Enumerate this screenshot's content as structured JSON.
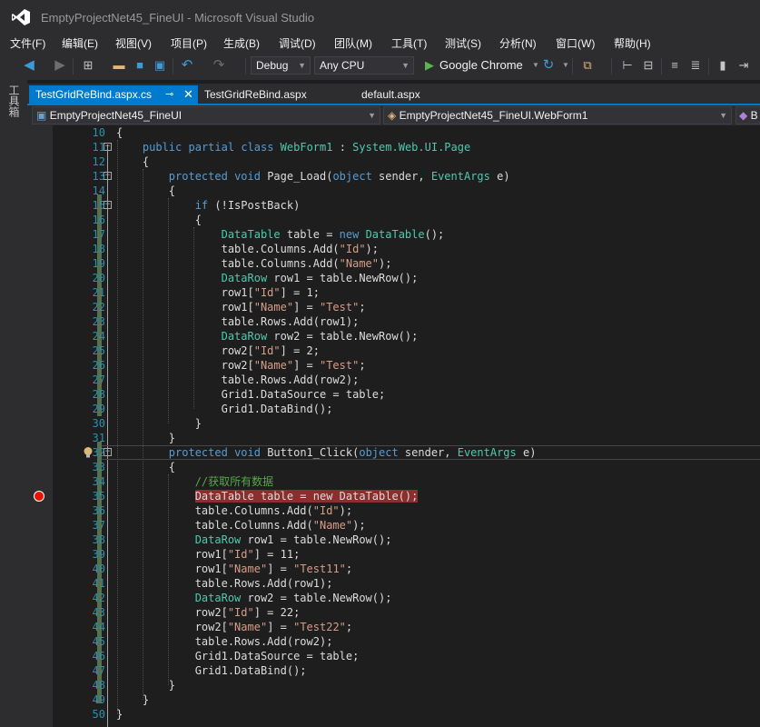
{
  "window": {
    "title": "EmptyProjectNet45_FineUI - Microsoft Visual Studio",
    "logo_icon": "visual-studio-logo-icon"
  },
  "menu": {
    "items": [
      "文件(F)",
      "编辑(E)",
      "视图(V)",
      "项目(P)",
      "生成(B)",
      "调试(D)",
      "团队(M)",
      "工具(T)",
      "测试(S)",
      "分析(N)",
      "窗口(W)",
      "帮助(H)"
    ]
  },
  "toolbar": {
    "configuration": "Debug",
    "platform": "Any CPU",
    "run_target": "Google Chrome",
    "icons": [
      "back-icon",
      "forward-icon",
      "new-project-icon",
      "open-icon",
      "save-icon",
      "save-all-icon",
      "undo-icon",
      "redo-icon",
      "start-icon",
      "refresh-icon",
      "browser-link-icon",
      "format-icon",
      "comment-icon",
      "uncomment-icon",
      "bookmark-icon",
      "next-bookmark-icon"
    ]
  },
  "toolbox": {
    "label": "工具箱"
  },
  "tabs": [
    {
      "label": "TestGridReBind.aspx.cs",
      "active": true,
      "pin": "⊸",
      "close": "✕"
    },
    {
      "label": "TestGridReBind.aspx",
      "active": false
    },
    {
      "label": "default.aspx",
      "active": false
    }
  ],
  "navigation": {
    "project": "EmptyProjectNet45_FineUI",
    "type": "EmptyProjectNet45_FineUI.WebForm1",
    "member": "B"
  },
  "editor": {
    "current_line": 32,
    "breakpoint_line": 35,
    "lightbulb_line": 32,
    "lines": [
      {
        "n": "10",
        "text": "{"
      },
      {
        "n": "11",
        "text": "    public partial class WebForm1 : System.Web.UI.Page"
      },
      {
        "n": "12",
        "text": "    {"
      },
      {
        "n": "13",
        "text": "        protected void Page_Load(object sender, EventArgs e)"
      },
      {
        "n": "14",
        "text": "        {"
      },
      {
        "n": "15",
        "text": "            if (!IsPostBack)"
      },
      {
        "n": "16",
        "text": "            {"
      },
      {
        "n": "17",
        "text": "                DataTable table = new DataTable();"
      },
      {
        "n": "18",
        "text": "                table.Columns.Add(\"Id\");"
      },
      {
        "n": "19",
        "text": "                table.Columns.Add(\"Name\");"
      },
      {
        "n": "20",
        "text": "                DataRow row1 = table.NewRow();"
      },
      {
        "n": "21",
        "text": "                row1[\"Id\"] = 1;"
      },
      {
        "n": "22",
        "text": "                row1[\"Name\"] = \"Test\";"
      },
      {
        "n": "23",
        "text": "                table.Rows.Add(row1);"
      },
      {
        "n": "24",
        "text": "                DataRow row2 = table.NewRow();"
      },
      {
        "n": "25",
        "text": "                row2[\"Id\"] = 2;"
      },
      {
        "n": "26",
        "text": "                row2[\"Name\"] = \"Test\";"
      },
      {
        "n": "27",
        "text": "                table.Rows.Add(row2);"
      },
      {
        "n": "28",
        "text": "                Grid1.DataSource = table;"
      },
      {
        "n": "29",
        "text": "                Grid1.DataBind();"
      },
      {
        "n": "30",
        "text": "            }"
      },
      {
        "n": "31",
        "text": "        }"
      },
      {
        "n": "32",
        "text": "        protected void Button1_Click(object sender, EventArgs e)"
      },
      {
        "n": "33",
        "text": "        {"
      },
      {
        "n": "34",
        "text": "            //获取所有数据"
      },
      {
        "n": "35",
        "text": "            DataTable table = new DataTable();"
      },
      {
        "n": "36",
        "text": "            table.Columns.Add(\"Id\");"
      },
      {
        "n": "37",
        "text": "            table.Columns.Add(\"Name\");"
      },
      {
        "n": "38",
        "text": "            DataRow row1 = table.NewRow();"
      },
      {
        "n": "39",
        "text": "            row1[\"Id\"] = 11;"
      },
      {
        "n": "40",
        "text": "            row1[\"Name\"] = \"Test11\";"
      },
      {
        "n": "41",
        "text": "            table.Rows.Add(row1);"
      },
      {
        "n": "42",
        "text": "            DataRow row2 = table.NewRow();"
      },
      {
        "n": "43",
        "text": "            row2[\"Id\"] = 22;"
      },
      {
        "n": "44",
        "text": "            row2[\"Name\"] = \"Test22\";"
      },
      {
        "n": "45",
        "text": "            table.Rows.Add(row2);"
      },
      {
        "n": "46",
        "text": "            Grid1.DataSource = table;"
      },
      {
        "n": "47",
        "text": "            Grid1.DataBind();"
      },
      {
        "n": "48",
        "text": "        }"
      },
      {
        "n": "49",
        "text": "    }"
      },
      {
        "n": "50",
        "text": "}"
      }
    ]
  },
  "colors": {
    "accent": "#007acc",
    "keyword": "#569cd6",
    "type": "#4ec9b0",
    "string": "#d69d85",
    "comment": "#57a64a",
    "number": "#b5cea8",
    "line_number": "#2b91af",
    "breakpoint": "#e51400"
  }
}
